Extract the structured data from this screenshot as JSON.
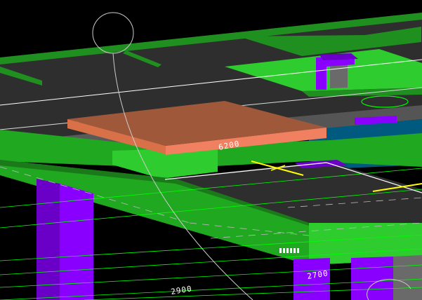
{
  "viewport": {
    "background": "#000000",
    "colors": {
      "slab_top": "#2e2e2e",
      "slab_green": "#21a821",
      "slab_green_bright": "#2ecc2e",
      "beam_green": "#1f8f1f",
      "column_purple": "#8a00ff",
      "column_purple_dark": "#6a00c8",
      "opening_orange": "#a0583a",
      "opening_orange_edge": "#f08060",
      "water_blue": "#005a80",
      "gridline": "#00ff00",
      "dim_line": "#ffffff",
      "yellow_marker": "#ffff00"
    },
    "icons": [
      "orbit-circle-icon",
      "vertical-axis-marker-icon"
    ]
  },
  "dimensions": {
    "opening_width_label": "6200",
    "bottom_left_label": "2900",
    "bottom_right_label": "2700"
  }
}
